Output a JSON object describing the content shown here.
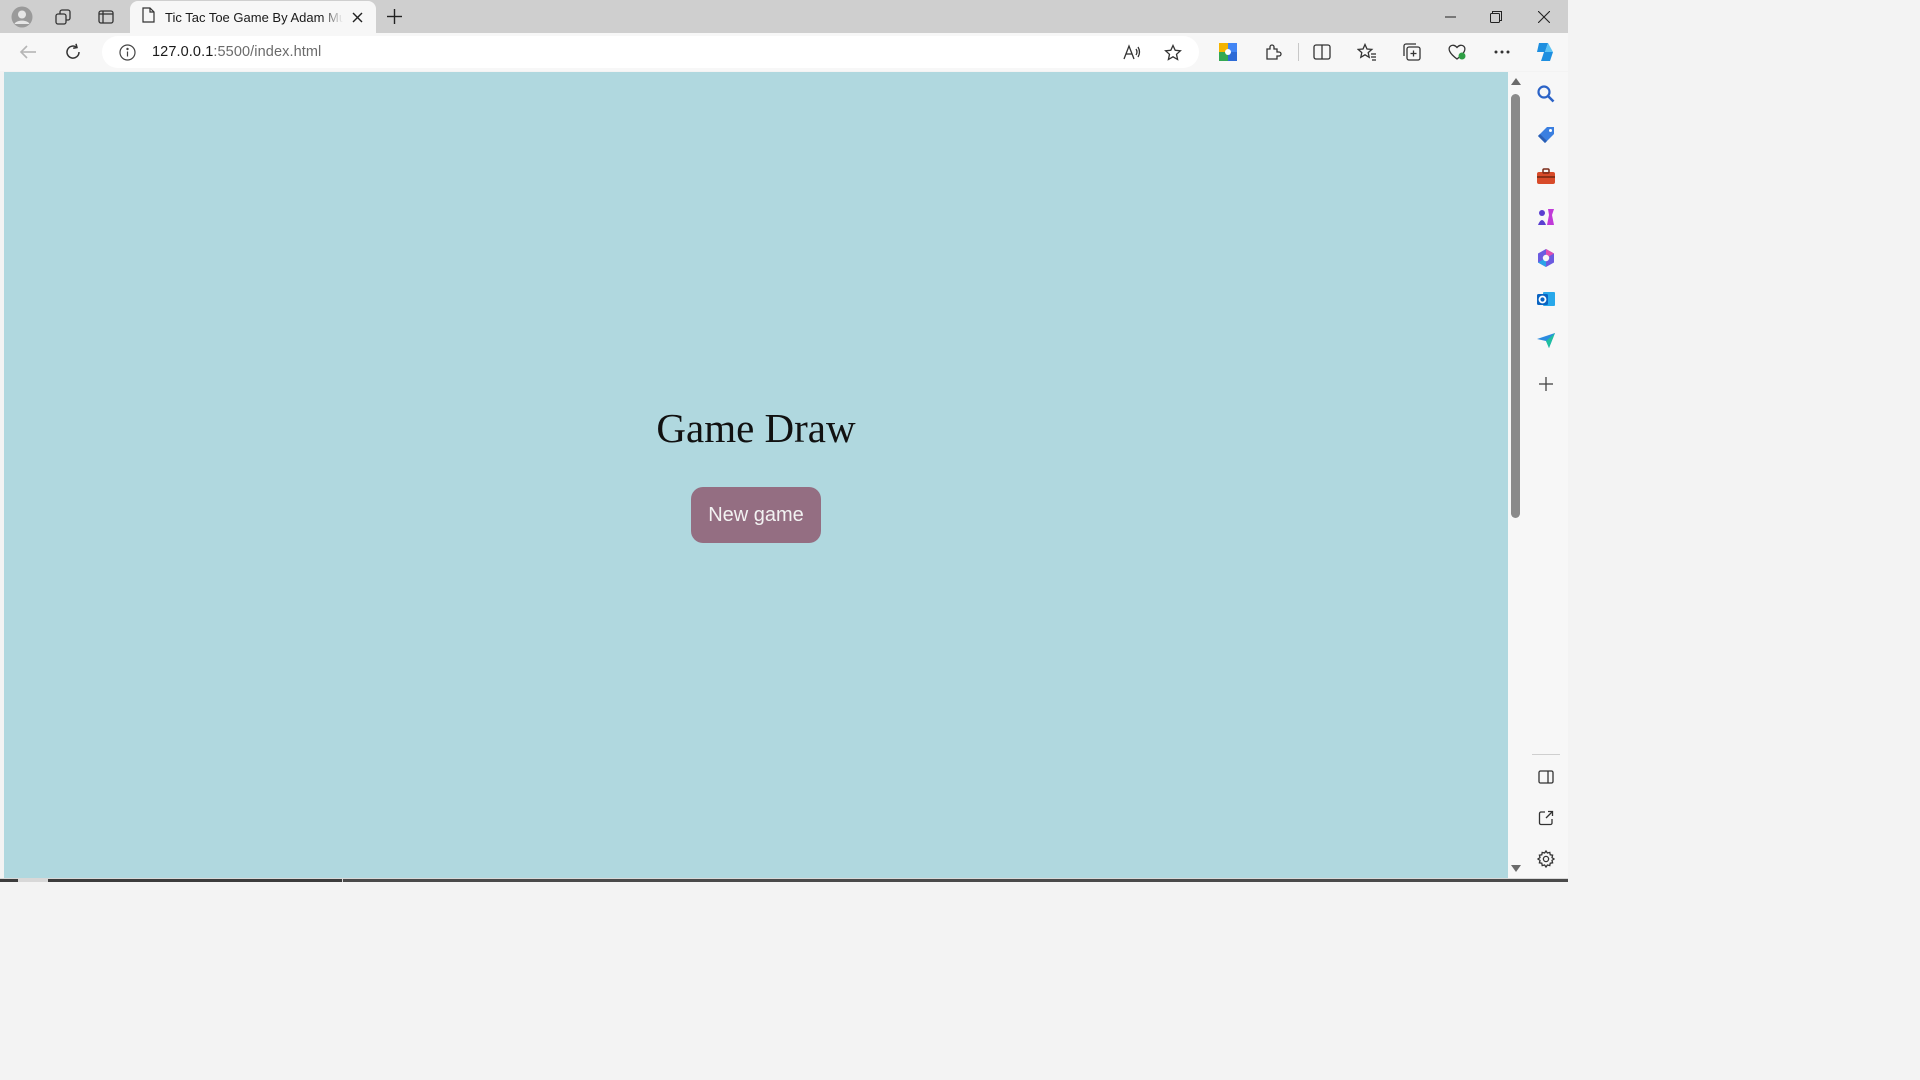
{
  "browser": {
    "tab_title": "Tic Tac Toe Game By Adam Mulaj",
    "address_host": "127.0.0.1",
    "address_rest": ":5500/index.html",
    "icons": {
      "profile": "profile-icon",
      "workspaces": "workspaces-icon",
      "tab_actions": "tab-actions-icon",
      "page": "page-icon",
      "close": "close-icon",
      "new_tab": "plus-icon",
      "back": "back-arrow-icon",
      "refresh": "refresh-icon",
      "info": "info-icon",
      "read_aloud": "read-aloud-icon",
      "favorite": "star-icon"
    }
  },
  "page": {
    "heading": "Game Draw",
    "new_game_label": "New game",
    "background_color": "#b0d8df",
    "button_color": "#946e82"
  }
}
